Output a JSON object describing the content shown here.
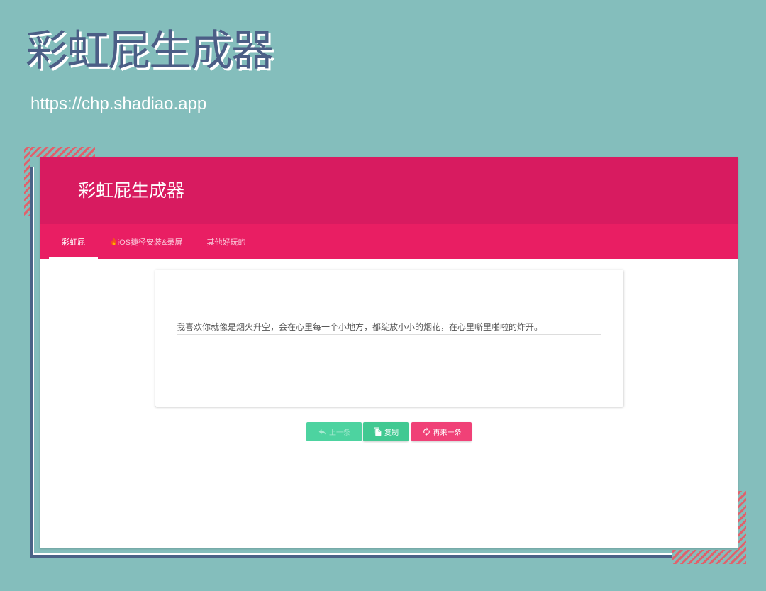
{
  "poster": {
    "title": "彩虹屁生成器",
    "url": "https://chp.shadiao.app"
  },
  "app": {
    "header": {
      "title": "彩虹屁生成器"
    },
    "tabs": [
      {
        "label": "彩虹屁",
        "active": true
      },
      {
        "label": "iOS捷径安装&录屏",
        "icon": "fire-icon",
        "active": false
      },
      {
        "label": "其他好玩的",
        "active": false
      }
    ],
    "compliment": {
      "text": "我喜欢你就像是烟火升空，会在心里每一个小地方，都绽放小小的烟花，在心里噼里啪啦的炸开。"
    },
    "buttons": {
      "previous": {
        "label": "上一条",
        "icon": "reply-arrow-icon",
        "disabled": true
      },
      "copy": {
        "label": "复制",
        "icon": "copy-icon",
        "disabled": false
      },
      "next": {
        "label": "再来一条",
        "icon": "refresh-icon",
        "disabled": false
      }
    }
  },
  "theme": {
    "background": "#84bebc",
    "poster_title": "#4b5e86",
    "frame": "#4b6387",
    "stripe": "#e1616b",
    "header": "#d81b60",
    "tabbar": "#e91e63",
    "previous_button": "#4dd3a0",
    "copy_button": "#41c992",
    "next_button": "#f04177"
  }
}
